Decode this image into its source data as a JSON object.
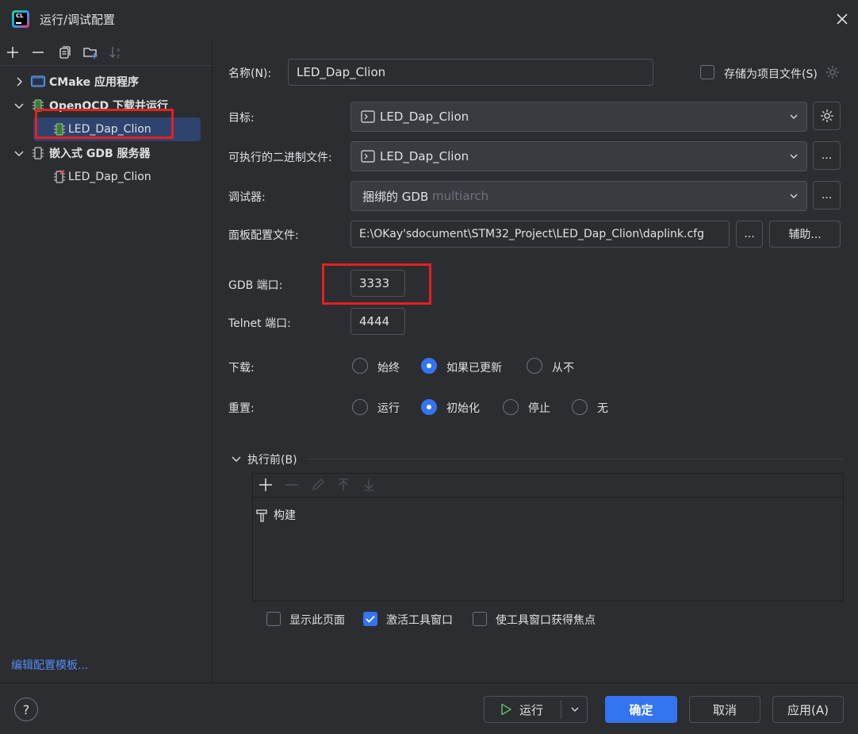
{
  "window": {
    "title": "运行/调试配置",
    "logo_text": "CL"
  },
  "tree": {
    "groups": [
      {
        "label": "CMake 应用程序",
        "expanded": false
      },
      {
        "label": "OpenOCD 下载并运行",
        "expanded": true,
        "children": [
          {
            "label": "LED_Dap_Clion",
            "selected": true
          }
        ]
      },
      {
        "label": "嵌入式 GDB 服务器",
        "expanded": true,
        "children": [
          {
            "label": "LED_Dap_Clion",
            "error": true
          }
        ]
      }
    ],
    "edit_templates_link": "编辑配置模板..."
  },
  "form": {
    "name_label": "名称(N):",
    "name_value": "LED_Dap_Clion",
    "store_as_project_label": "存储为项目文件(S)",
    "store_as_project_checked": false,
    "target_label": "目标:",
    "target_value": "LED_Dap_Clion",
    "executable_label": "可执行的二进制文件:",
    "executable_value": "LED_Dap_Clion",
    "debugger_label": "调试器:",
    "debugger_value": "捆绑的 GDB",
    "debugger_value_muted": "multiarch",
    "board_config_label": "面板配置文件:",
    "board_config_value": "E:\\OKay'sdocument\\STM32_Project\\LED_Dap_Clion\\daplink.cfg",
    "browse_label": "...",
    "assist_label": "辅助...",
    "gdb_port_label": "GDB 端口:",
    "gdb_port_value": "3333",
    "telnet_port_label": "Telnet 端口:",
    "telnet_port_value": "4444",
    "download_label": "下载:",
    "download_options": [
      "始终",
      "如果已更新",
      "从不"
    ],
    "download_selected": "如果已更新",
    "reset_label": "重置:",
    "reset_options": [
      "运行",
      "初始化",
      "停止",
      "无"
    ],
    "reset_selected": "初始化"
  },
  "before_launch": {
    "title": "执行前(B)",
    "tasks": [
      "构建"
    ],
    "show_page_label": "显示此页面",
    "show_page_checked": false,
    "activate_tool_window_label": "激活工具窗口",
    "activate_tool_window_checked": true,
    "focus_tool_window_label": "使工具窗口获得焦点",
    "focus_tool_window_checked": false
  },
  "footer": {
    "help_label": "?",
    "run_label": "运行",
    "ok_label": "确定",
    "cancel_label": "取消",
    "apply_label": "应用(A)"
  },
  "colors": {
    "background": "#2b2d30",
    "accent": "#3574f0",
    "selection": "#2e436e",
    "highlight_box": "#e52020",
    "link": "#548af7"
  }
}
